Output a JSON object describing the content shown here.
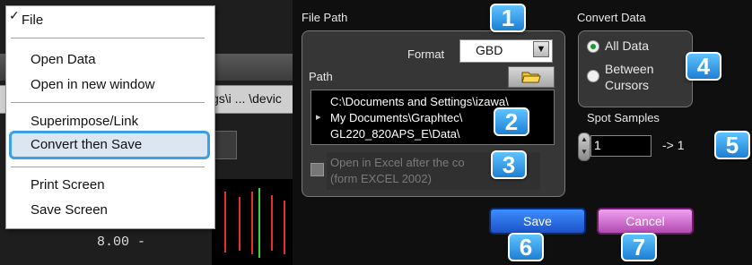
{
  "menu": {
    "file_label": "File",
    "open_data": "Open Data",
    "open_new_window": "Open in new window",
    "superimpose": "Superimpose/Link",
    "convert_then_save": "Convert then Save",
    "print_screen": "Print Screen",
    "save_screen": "Save Screen"
  },
  "background_app": {
    "path_text": "gs\\i ... \\devic",
    "y_tick": "8.00 -"
  },
  "dialog": {
    "file_path_label": "File Path",
    "format_label": "Format",
    "format_value": "GBD",
    "path_label": "Path",
    "path_lines": [
      "C:\\Documents and Settings\\izawa\\",
      "My Documents\\Graphtec\\",
      "GL220_820APS_E\\Data\\"
    ],
    "excel_lines": [
      "Open in Excel after the co",
      "(form EXCEL 2002)"
    ],
    "convert_data_label": "Convert Data",
    "radio_all": "All Data",
    "radio_between_1": "Between",
    "radio_between_2": "Cursors",
    "spot_samples_label": "Spot Samples",
    "spot_value": "1",
    "spot_result": "-> 1",
    "save_label": "Save",
    "cancel_label": "Cancel"
  },
  "badges": [
    "1",
    "2",
    "3",
    "4",
    "5",
    "6",
    "7"
  ],
  "colors": {
    "highlight_border": "#3aa0e8",
    "badge_blue": "#1d7fd4",
    "save_blue": "#1b52c8",
    "cancel_pink": "#b24ab2",
    "radio_green": "#1d9a2c"
  },
  "icons": {
    "check": "checkmark-icon",
    "folder": "folder-icon",
    "dropdown": "chevron-down-icon",
    "spinner": "spinner-arrows-icon"
  }
}
